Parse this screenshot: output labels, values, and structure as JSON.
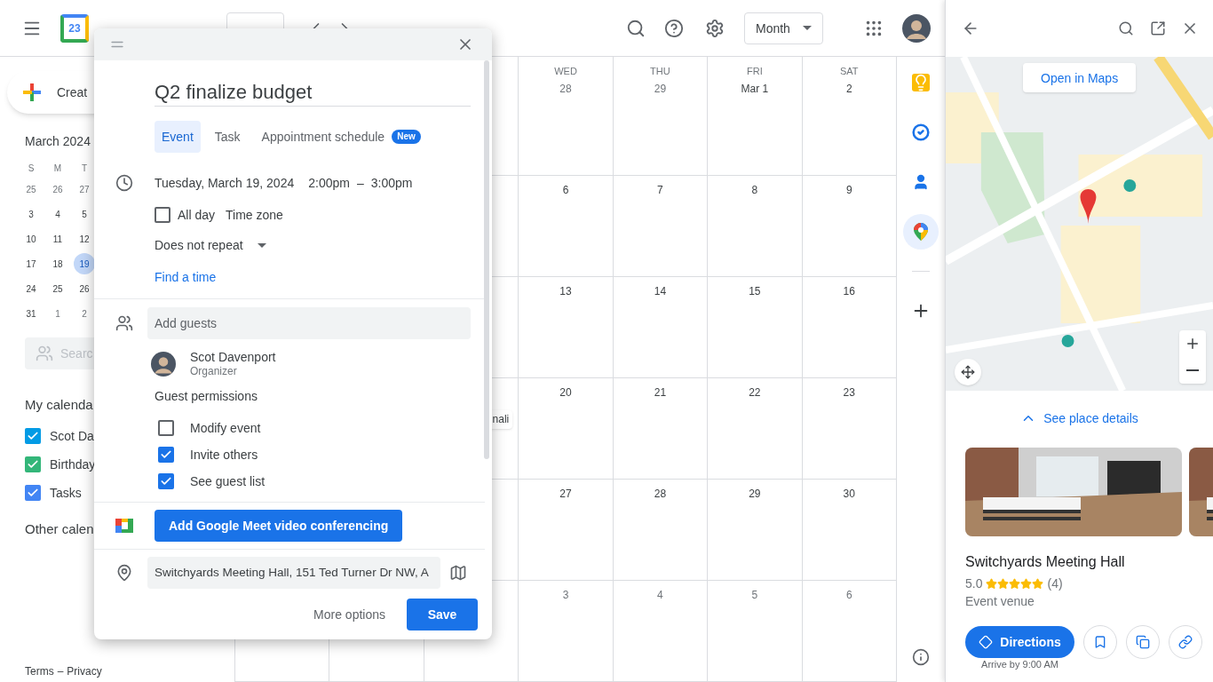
{
  "header": {
    "logo_text": "23",
    "view_select": "Month"
  },
  "sidebar": {
    "create_button": "Creat",
    "mini_calendar": {
      "title": "March 2024",
      "weekdays": [
        "S",
        "M",
        "T"
      ],
      "weeks": [
        [
          {
            "day": "25",
            "muted": true,
            "selected": false
          },
          {
            "day": "26",
            "muted": true,
            "selected": false
          },
          {
            "day": "27",
            "muted": true,
            "selected": false
          }
        ],
        [
          {
            "day": "3",
            "muted": false,
            "selected": false
          },
          {
            "day": "4",
            "muted": false,
            "selected": false
          },
          {
            "day": "5",
            "muted": false,
            "selected": false
          }
        ],
        [
          {
            "day": "10",
            "muted": false,
            "selected": false
          },
          {
            "day": "11",
            "muted": false,
            "selected": false
          },
          {
            "day": "12",
            "muted": false,
            "selected": false
          }
        ],
        [
          {
            "day": "17",
            "muted": false,
            "selected": false
          },
          {
            "day": "18",
            "muted": false,
            "selected": false
          },
          {
            "day": "19",
            "muted": false,
            "selected": true
          }
        ],
        [
          {
            "day": "24",
            "muted": false,
            "selected": false
          },
          {
            "day": "25",
            "muted": false,
            "selected": false
          },
          {
            "day": "26",
            "muted": false,
            "selected": false
          }
        ],
        [
          {
            "day": "31",
            "muted": false,
            "selected": false
          },
          {
            "day": "1",
            "muted": true,
            "selected": false
          },
          {
            "day": "2",
            "muted": true,
            "selected": false
          }
        ]
      ]
    },
    "people_search": {
      "placeholder": "Searc"
    },
    "my_calendars": {
      "title": "My calenda",
      "items": [
        {
          "label": "Scot Da",
          "checked": true,
          "color": "#039be5"
        },
        {
          "label": "Birthday",
          "checked": true,
          "color": "#33b679"
        },
        {
          "label": "Tasks",
          "checked": true,
          "color": "#4285f4"
        }
      ]
    },
    "other_calendars": {
      "title": "Other calen"
    },
    "footer": {
      "links": [
        "Terms",
        "Privacy"
      ],
      "separator": "–"
    }
  },
  "calendar": {
    "weekdays": [
      "WED",
      "THU",
      "FRI",
      "SAT"
    ],
    "weeks": [
      {
        "days": [
          {
            "day": "28",
            "muted": true
          },
          {
            "day": "29",
            "muted": true
          },
          {
            "day": "Mar 1",
            "muted": false
          },
          {
            "day": "2",
            "muted": false
          }
        ]
      },
      {
        "days": [
          {
            "day": "6",
            "muted": false
          },
          {
            "day": "7",
            "muted": false
          },
          {
            "day": "8",
            "muted": false
          },
          {
            "day": "9",
            "muted": false
          }
        ]
      },
      {
        "days": [
          {
            "day": "13",
            "muted": false
          },
          {
            "day": "14",
            "muted": false
          },
          {
            "day": "15",
            "muted": false
          },
          {
            "day": "16",
            "muted": false
          }
        ]
      },
      {
        "days": [
          {
            "day": "20",
            "muted": false
          },
          {
            "day": "21",
            "muted": false
          },
          {
            "day": "22",
            "muted": false
          },
          {
            "day": "23",
            "muted": false
          }
        ],
        "partial_event": {
          "text": "nali"
        }
      },
      {
        "days": [
          {
            "day": "27",
            "muted": false
          },
          {
            "day": "28",
            "muted": false
          },
          {
            "day": "29",
            "muted": false
          },
          {
            "day": "30",
            "muted": false
          }
        ]
      },
      {
        "days": [
          {
            "day": "3",
            "muted": true
          },
          {
            "day": "4",
            "muted": true
          },
          {
            "day": "5",
            "muted": true
          },
          {
            "day": "6",
            "muted": true
          }
        ]
      }
    ]
  },
  "side_rail": {
    "items": [
      {
        "kind": "keep",
        "selected": false
      },
      {
        "kind": "tasks",
        "selected": false
      },
      {
        "kind": "contacts",
        "selected": false
      },
      {
        "kind": "maps",
        "selected": true
      }
    ]
  },
  "dialog": {
    "title": "Q2 finalize budget",
    "tabs": [
      {
        "label": "Event",
        "selected": true
      },
      {
        "label": "Task",
        "selected": false
      },
      {
        "label": "Appointment schedule",
        "selected": false,
        "badge": "New"
      }
    ],
    "date": "Tuesday, March 19, 2024",
    "start_time": "2:00pm",
    "time_separator": "–",
    "end_time": "3:00pm",
    "all_day": {
      "label": "All day",
      "checked": false
    },
    "time_zone": "Time zone",
    "repeat": "Does not repeat",
    "find_time": "Find a time",
    "guests_field": {
      "placeholder": "Add guests"
    },
    "organizer": {
      "name": "Scot Davenport",
      "role": "Organizer"
    },
    "permissions": {
      "title": "Guest permissions",
      "items": [
        {
          "label": "Modify event",
          "checked": false
        },
        {
          "label": "Invite others",
          "checked": true
        },
        {
          "label": "See guest list",
          "checked": true
        }
      ]
    },
    "meet_button": "Add Google Meet video conferencing",
    "location": {
      "value": "Switchyards Meeting Hall, 151 Ted Turner Dr NW, A"
    },
    "more_options": "More options",
    "save": "Save"
  },
  "maps_panel": {
    "open_in_maps": "Open in Maps",
    "see_details": "See place details",
    "place": {
      "name": "Switchyards Meeting Hall",
      "rating": "5.0",
      "stars": 5,
      "reviews": "(4)",
      "category": "Event venue"
    },
    "directions": "Directions",
    "arrival": "Arrive by 9:00 AM"
  }
}
